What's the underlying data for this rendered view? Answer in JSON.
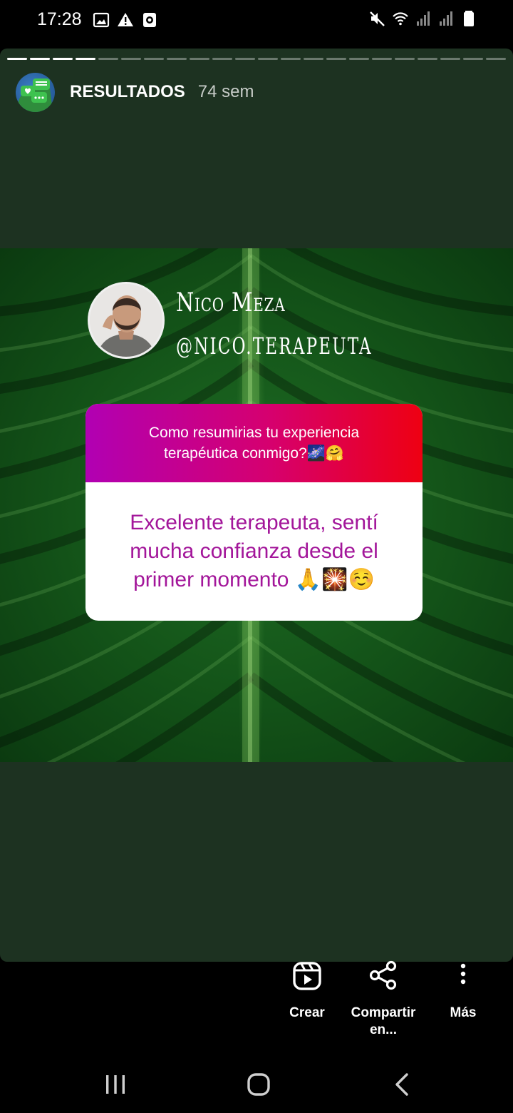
{
  "status_bar": {
    "time": "17:28",
    "left_icons": [
      "gallery-icon",
      "warning-icon",
      "screen-record-icon"
    ],
    "right_icons": [
      "mute-icon",
      "wifi-icon",
      "signal-icon",
      "signal-icon",
      "battery-icon"
    ]
  },
  "story": {
    "account_name": "RESULTADOS",
    "time_ago": "74 sem",
    "progress_segments": 22,
    "progress_done": 4,
    "profile": {
      "name": "Nico Meza",
      "handle": "@nico.terapeuta"
    },
    "question": "Como resumirias tu experiencia terapéutica conmigo?🌌🤗",
    "answer": "Excelente terapeuta, sentí mucha confianza desde el primer momento 🙏🎇☺️",
    "colors": {
      "story_background": "#1d3221",
      "question_gradient_start": "#b100b3",
      "question_gradient_end": "#ee0012",
      "answer_text": "#a3169a"
    }
  },
  "actions": {
    "create_label": "Crear",
    "share_label": "Compartir en...",
    "more_label": "Más"
  },
  "nav": {
    "buttons": [
      "recent-apps-icon",
      "home-icon",
      "back-icon"
    ]
  }
}
